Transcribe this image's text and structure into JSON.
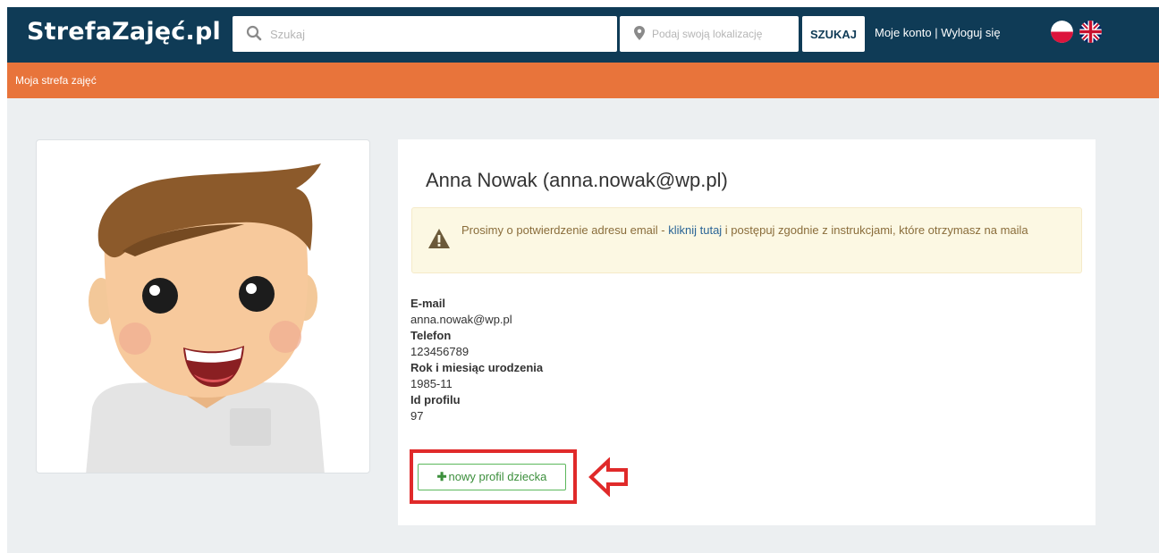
{
  "navbar": {
    "brand": "StrefaZajęć.pl",
    "search_placeholder": "Szukaj",
    "location_placeholder": "Podaj swoją lokalizację",
    "search_button": "SZUKAJ",
    "account_link": "Moje konto",
    "separator": " | ",
    "logout_link": "Wyloguj się",
    "languages": [
      "pl",
      "en"
    ]
  },
  "subnav": {
    "link": "Moja strefa zajęć"
  },
  "profile": {
    "title": "Anna Nowak (anna.nowak@wp.pl)",
    "alert": {
      "before": "Prosimy o potwierdzenie adresu email - ",
      "link": "kliknij tutaj",
      "after": " i postępuj zgodnie z instrukcjami, które otrzymasz na maila"
    },
    "fields": {
      "email_label": "E-mail",
      "email_value": "anna.nowak@wp.pl",
      "phone_label": "Telefon",
      "phone_value": "123456789",
      "birth_label": "Rok i miesiąc urodzenia",
      "birth_value": "1985-11",
      "id_label": "Id profilu",
      "id_value": "97"
    },
    "new_child_button": "nowy profil dziecka"
  },
  "colors": {
    "navbar": "#0f3b56",
    "subbar": "#e8743b",
    "background": "#eceff1",
    "highlight": "#e02a2a",
    "button_green": "#5cb85c"
  },
  "icons": [
    "search-icon",
    "map-marker-icon",
    "poland-flag-icon",
    "uk-flag-icon",
    "warning-icon",
    "plus-icon",
    "arrow-left-icon"
  ]
}
